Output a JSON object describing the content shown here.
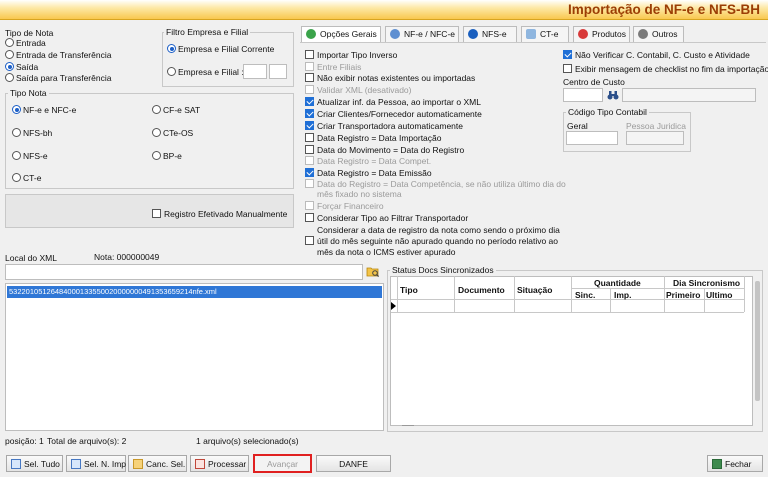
{
  "title": "Importação de NF-e e NFS-BH",
  "tipo_nota_group": {
    "label": "Tipo de Nota",
    "options": [
      "Entrada",
      "Entrada de Transferência",
      "Saída",
      "Saída para Transferência"
    ],
    "selected": "Saída"
  },
  "filtro_group": {
    "label": "Filtro Empresa e Filial",
    "option1": "Empresa e Filial Corrente",
    "option2": "Empresa e Filial :"
  },
  "tipo_nota2_group": {
    "label": "Tipo Nota",
    "col1": [
      "NF-e e NFC-e",
      "NFS-bh",
      "NFS-e",
      "CT-e"
    ],
    "col2": [
      "CF-e SAT",
      "CTe-OS",
      "BP-e"
    ],
    "selected": "NF-e e NFC-e"
  },
  "registro_efetivado": "Registro Efetivado Manualmente",
  "local_xml_label": "Local do XML",
  "nota_label": "Nota: 000000049",
  "file_list": [
    "53220105126484000133550020000000491353659214nfe.xml"
  ],
  "status_line": {
    "posicao": "posição: 1",
    "total": "Total de arquivo(s): 2",
    "selecionados": "1 arquivo(s) selecionado(s)"
  },
  "tabs": [
    "Opções Gerais",
    "NF-e / NFC-e",
    "NFS-e",
    "CT-e",
    "Produtos",
    "Outros"
  ],
  "options_left": [
    {
      "label": "Importar Tipo Inverso",
      "checked": false,
      "disabled": false
    },
    {
      "label": "Entre Filiais",
      "checked": false,
      "disabled": true
    },
    {
      "label": "Não exibir notas existentes ou importadas",
      "checked": false,
      "disabled": false
    },
    {
      "label": "Validar XML (desativado)",
      "checked": false,
      "disabled": true
    },
    {
      "label": "Atualizar inf. da Pessoa, ao importar o XML",
      "checked": true,
      "disabled": false
    },
    {
      "label": "Criar Clientes/Fornecedor automaticamente",
      "checked": true,
      "disabled": false
    },
    {
      "label": "Criar Transportadora automaticamente",
      "checked": true,
      "disabled": false
    },
    {
      "label": "Data Registro = Data Importação",
      "checked": false,
      "disabled": false
    },
    {
      "label": "Data do Movimento = Data do Registro",
      "checked": false,
      "disabled": false
    },
    {
      "label": "Data Registro = Data Compet.",
      "checked": false,
      "disabled": true
    },
    {
      "label": "Data Registro = Data Emissão",
      "checked": true,
      "disabled": false
    }
  ],
  "option_multiline1": [
    "Data do Registro = Data Competência, se não utiliza último dia do",
    "mês fixado no sistema"
  ],
  "forcar_financeiro": "Forçar Financeiro",
  "considerar_tipo": "Considerar Tipo ao Filtrar Transportador",
  "considerar_data": [
    "Considerar a data de registro da nota como sendo o próximo dia",
    "útil do mês seguinte não apurado quando no período relativo ao",
    "mês da nota o ICMS estiver apurado"
  ],
  "options_right": {
    "nao_verificar": "Não Verificar C. Contabil, C. Custo e Atividade",
    "exibir_mensagem": "Exibir mensagem de checklist no fim da importação",
    "centro_custo": "Centro de Custo",
    "codigo_tipo": "Código Tipo Contabil",
    "geral": "Geral",
    "pessoa_juridica": "Pessoa Juridica"
  },
  "status_docs": {
    "label": "Status Docs Sincronizados",
    "columns": [
      "Tipo",
      "Documento",
      "Situação"
    ],
    "quantidade": "Quantidade",
    "quantidade_sub": [
      "Sinc.",
      "Imp."
    ],
    "dia": "Dia Sincronismo",
    "dia_sub": [
      "Primeiro",
      "Ultimo"
    ]
  },
  "buttons": {
    "sel_tudo": "Sel. Tudo",
    "sel_n_imp": "Sel. N. Imp",
    "canc_sel": "Canc. Sel.",
    "processar": "Processar",
    "avancar": "Avançar",
    "danfe": "DANFE",
    "fechar": "Fechar"
  },
  "colors": {
    "accent_title": "#9b3d05",
    "highlight_red": "#e02020",
    "selection_blue": "#2f77d6"
  }
}
